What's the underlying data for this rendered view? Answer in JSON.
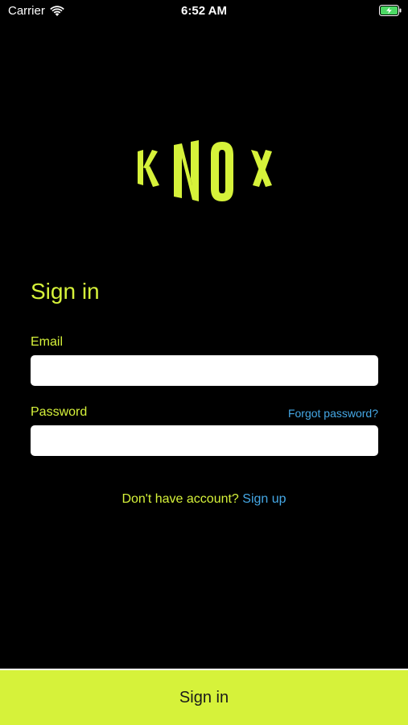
{
  "status_bar": {
    "carrier": "Carrier",
    "time": "6:52 AM"
  },
  "logo": {
    "letters": [
      "K",
      "N",
      "O",
      "X"
    ],
    "color": "#d6f23a"
  },
  "form": {
    "title": "Sign in",
    "email_label": "Email",
    "email_value": "",
    "password_label": "Password",
    "password_value": "",
    "forgot_password": "Forgot password?",
    "signup_prompt": "Don't have account?",
    "signup_link": "Sign up"
  },
  "footer": {
    "signin_button": "Sign in"
  },
  "colors": {
    "background": "#000000",
    "accent": "#d6f23a",
    "link": "#45a8e6",
    "input_bg": "#ffffff"
  }
}
